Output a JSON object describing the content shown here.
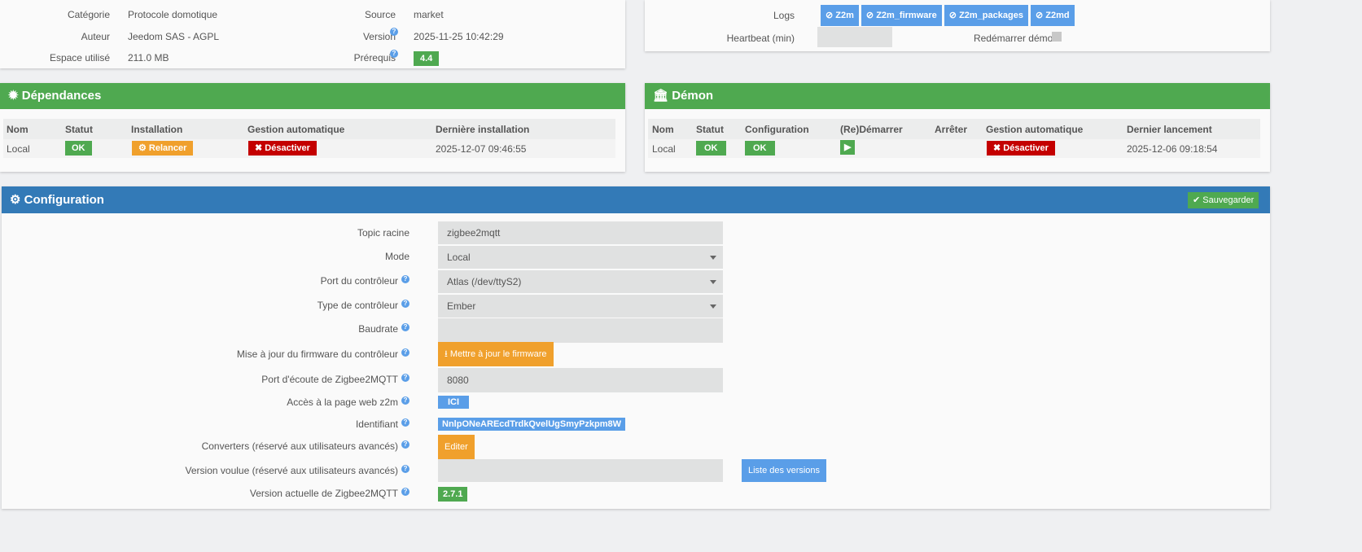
{
  "info": {
    "categorie_label": "Catégorie",
    "categorie": "Protocole domotique",
    "auteur_label": "Auteur",
    "auteur": "Jeedom SAS - AGPL",
    "espace_label": "Espace utilisé",
    "espace": "211.0 MB",
    "source_label": "Source",
    "source": "market",
    "version_label": "Version",
    "version": "2025-11-25 10:42:29",
    "prerequis_label": "Prérequis",
    "prerequis": "4.4"
  },
  "logs": {
    "label": "Logs",
    "buttons": [
      "Z2m",
      "Z2m_firmware",
      "Z2m_packages",
      "Z2md"
    ],
    "heartbeat_label": "Heartbeat (min)",
    "restart_label": "Redémarrer démon"
  },
  "deps": {
    "title": "Dépendances",
    "headers": [
      "Nom",
      "Statut",
      "Installation",
      "Gestion automatique",
      "Dernière installation"
    ],
    "row": {
      "nom": "Local",
      "statut": "OK",
      "install": "Relancer",
      "gestion": "Désactiver",
      "date": "2025-12-07 09:46:55"
    }
  },
  "demon": {
    "title": "Démon",
    "headers": [
      "Nom",
      "Statut",
      "Configuration",
      "(Re)Démarrer",
      "Arrêter",
      "Gestion automatique",
      "Dernier lancement"
    ],
    "row": {
      "nom": "Local",
      "statut": "OK",
      "config": "OK",
      "gestion": "Désactiver",
      "date": "2025-12-06 09:18:54"
    }
  },
  "config": {
    "title": "Configuration",
    "save": "Sauvegarder",
    "topic_label": "Topic racine",
    "topic": "zigbee2mqtt",
    "mode_label": "Mode",
    "mode": "Local",
    "port_label": "Port du contrôleur",
    "port": "Atlas (/dev/ttyS2)",
    "type_label": "Type de contrôleur",
    "type": "Ember",
    "baud_label": "Baudrate",
    "fw_label": "Mise à jour du firmware du contrôleur",
    "fw_button": "Mettre à jour le firmware",
    "listen_label": "Port d'écoute de Zigbee2MQTT",
    "listen": "8080",
    "web_label": "Accès à la page web z2m",
    "web_button": "ICI",
    "id_label": "Identifiant",
    "id": "NnlpONeAREcdTrdkQvelUgSmyPzkpm8W",
    "conv_label": "Converters (réservé aux utilisateurs avancés)",
    "conv_button": "Editer",
    "wanted_label": "Version voulue (réservé aux utilisateurs avancés)",
    "versions_button": "Liste des versions",
    "current_label": "Version actuelle de Zigbee2MQTT",
    "current": "2.7.1"
  }
}
